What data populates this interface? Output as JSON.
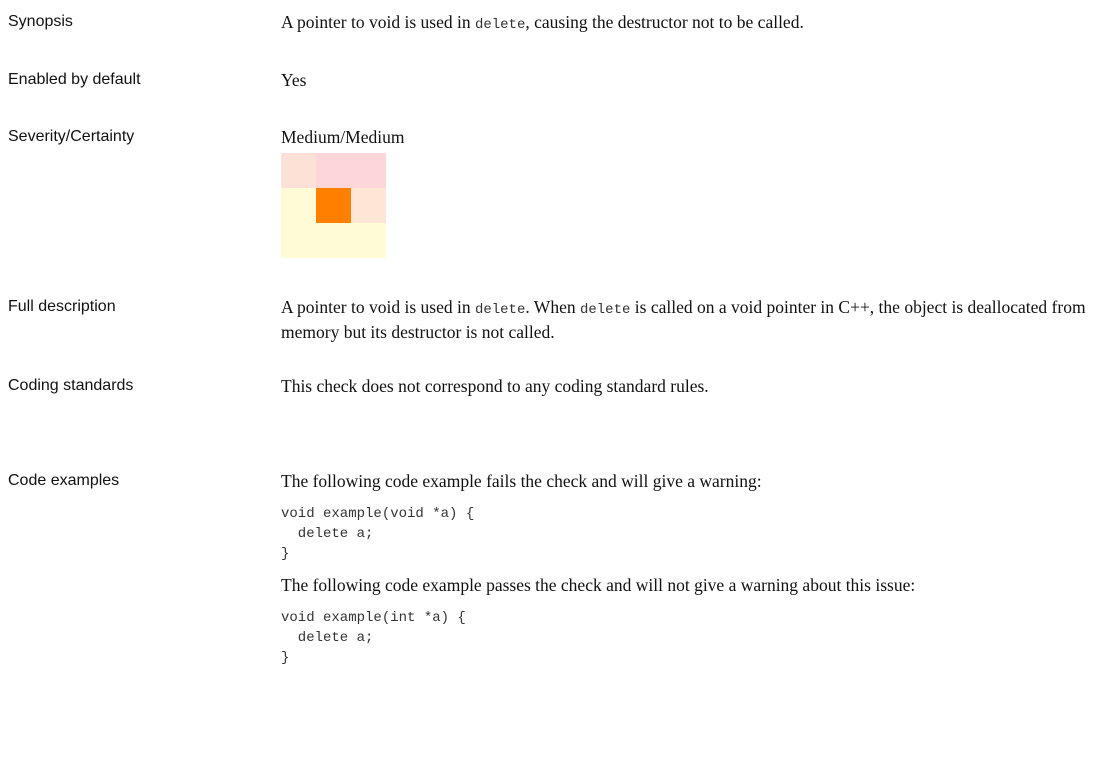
{
  "rows": {
    "synopsis": {
      "label": "Synopsis",
      "text_before": "A pointer to void is used in ",
      "code": "delete",
      "text_after": ", causing the destructor not to be called."
    },
    "enabled": {
      "label": "Enabled by default",
      "value": "Yes"
    },
    "severity": {
      "label": "Severity/Certainty",
      "value": "Medium/Medium",
      "grid_colors": {
        "cells": [
          [
            "#fde0d6",
            "#fcd6d8",
            "#fcd6d8"
          ],
          [
            "#fffbd6",
            "#ff8000",
            "#fde6d6"
          ],
          [
            "#fffbd6",
            "#fffbd6",
            "#fffbd6"
          ]
        ]
      }
    },
    "full_description": {
      "label": "Full description",
      "part1": "A pointer to void is used in ",
      "code1": "delete",
      "part2": ". When ",
      "code2": "delete",
      "part3": " is called on a void pointer in C++, the object is deallocated from memory but its destructor is not called."
    },
    "coding_standards": {
      "label": "Coding standards",
      "value": "This check does not correspond to any coding standard rules."
    },
    "code_examples": {
      "label": "Code examples",
      "fail_intro": "The following code example fails the check and will give a warning:",
      "fail_code": "void example(void *a) {\n  delete a;\n}",
      "pass_intro": "The following code example passes the check and will not give a warning about this issue:",
      "pass_code": "void example(int *a) {\n  delete a;\n}"
    }
  }
}
